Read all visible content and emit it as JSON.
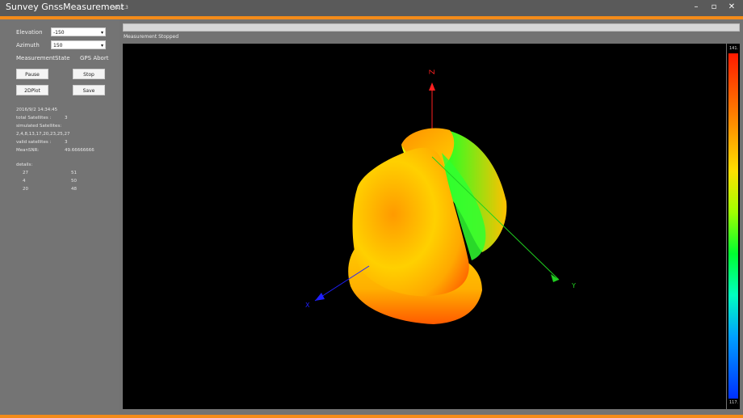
{
  "app": {
    "title": "Sunvey GnssMeasurement",
    "version": "v1.2.3"
  },
  "window_controls": {
    "minimize": "–",
    "maximize": "▫",
    "close": "✕"
  },
  "controls": {
    "elevation_label": "Elevation",
    "elevation_value": "-150",
    "azimuth_label": "Azimuth",
    "azimuth_value": "150",
    "measurement_state_label": "MeasurementState",
    "measurement_state_value": "GPS Abort",
    "pause_label": "Pause",
    "stop_label": "Stop",
    "plot2d_label": "2DPlot",
    "save_label": "Save",
    "dropdown_arrow": "▾"
  },
  "info": {
    "timestamp": "2016/9/2 14:34:45",
    "total_label": "total Satellites :",
    "total_value": "3",
    "simulated_label": "simulated Satellites:",
    "simulated_list": "2,4,8,13,17,20,23,25,27",
    "valid_label": "valid satellites :",
    "valid_value": "3",
    "meansnr_label": "MeanSNR:",
    "meansnr_value": "49.66666666",
    "details_label": "details:",
    "details": [
      {
        "sat": "27",
        "snr": "51"
      },
      {
        "sat": "4",
        "snr": "50"
      },
      {
        "sat": "20",
        "snr": "48"
      }
    ]
  },
  "status": {
    "text": "Measurement Stopped"
  },
  "plot": {
    "axis_z": "Z",
    "axis_y": "Y",
    "axis_x": "X"
  },
  "colorbar": {
    "top_label": "141.",
    "bottom_label": "117."
  },
  "colors": {
    "accent": "#f38b19",
    "axis_z": "#ff2020",
    "axis_y": "#20d020",
    "axis_x": "#2020ff"
  }
}
